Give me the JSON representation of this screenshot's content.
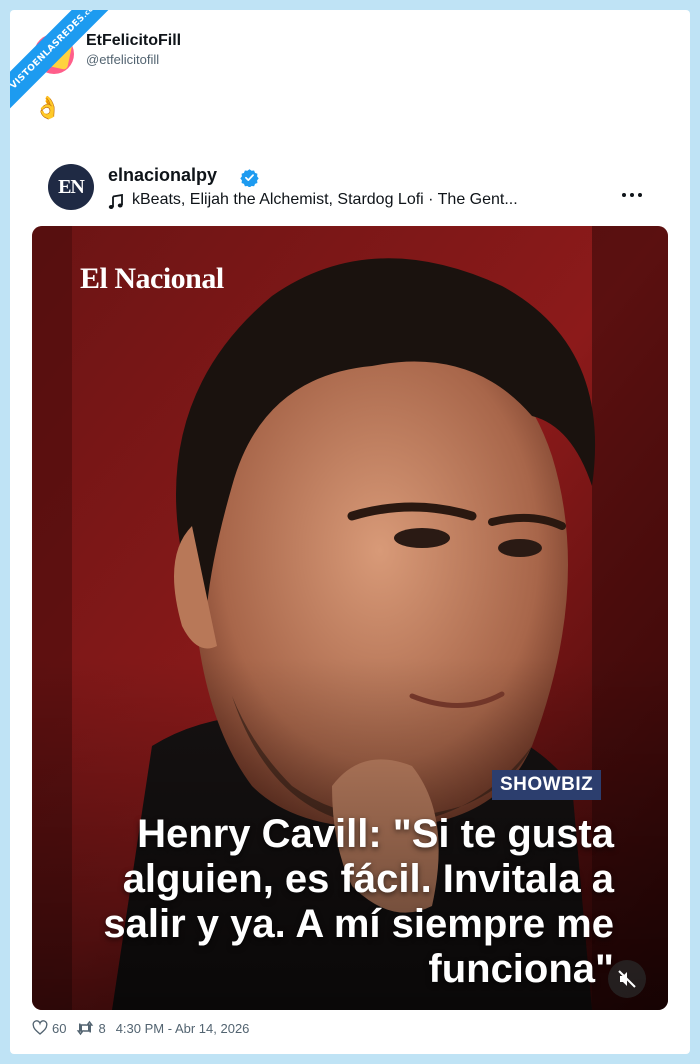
{
  "watermark": {
    "text": "VISTOENLASREDES",
    "suffix": ".com"
  },
  "tweet": {
    "author_name": "EtFelicitoFill",
    "author_handle": "@etfelicitofill",
    "body_emoji": "👌"
  },
  "embed": {
    "avatar_initials": "EN",
    "author": "elnacionalpy",
    "music": "kBeats, Elijah the Alchemist, Stardog Lofi · The Gent...",
    "media": {
      "brand": "El Nacional",
      "badge": "SHOWBIZ",
      "headline": "Henry Cavill: \"Si te gusta alguien, es fácil. Invitala a salir y ya. A mí siempre me funciona\""
    }
  },
  "footer": {
    "likes": "60",
    "retweets": "8",
    "timestamp": "4:30 PM - Abr 14, 2026"
  },
  "colors": {
    "verified": "#1d9bf0",
    "badge": "#2c3e6e",
    "background": "#bfe3f5"
  }
}
